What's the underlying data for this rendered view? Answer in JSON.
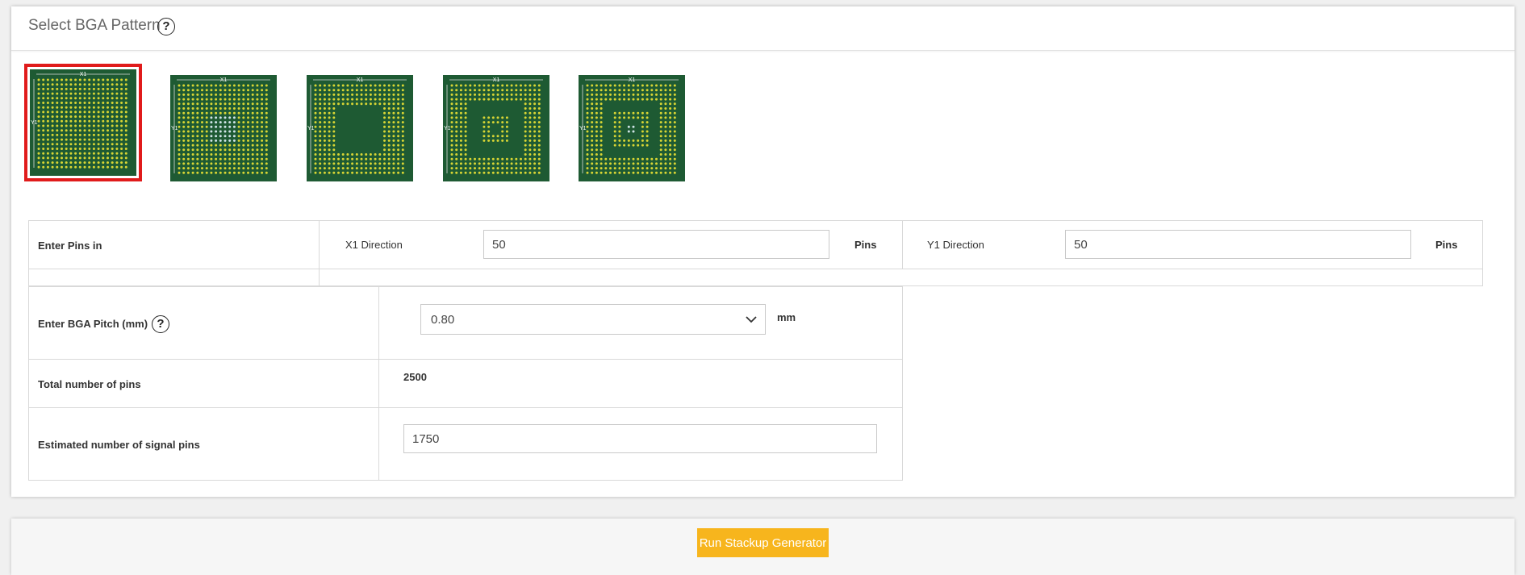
{
  "header": {
    "title": "Select BGA Pattern",
    "help_glyph": "?"
  },
  "patterns": [
    {
      "label_top": "X1",
      "label_side": "Y1",
      "selected": true
    },
    {
      "label_top": "X1",
      "label_side": "Y1",
      "selected": false
    },
    {
      "label_top": "X1",
      "label_side": "Y1",
      "selected": false
    },
    {
      "label_top": "X1",
      "label_side": "Y1",
      "selected": false
    },
    {
      "label_top": "X1",
      "label_side": "Y1",
      "selected": false
    }
  ],
  "pins": {
    "label": "Enter Pins in",
    "x1_label": "X1 Direction",
    "x1_value": "50",
    "x1_unit": "Pins",
    "y1_label": "Y1 Direction",
    "y1_value": "50",
    "y1_unit": "Pins"
  },
  "pitch": {
    "label": "Enter BGA Pitch (mm)",
    "help_glyph": "?",
    "selected": "0.80",
    "unit": "mm"
  },
  "total": {
    "label": "Total number of pins",
    "value": "2500"
  },
  "signal": {
    "label": "Estimated number of signal pins",
    "value": "1750"
  },
  "footer": {
    "run_label": "Run Stackup Generator"
  },
  "colors": {
    "board": "#1e5a33",
    "pin": "#d8d534",
    "pin_alt": "#cfe3e6",
    "selected_outline": "#e01b1b",
    "run_button": "#f7b51d"
  }
}
